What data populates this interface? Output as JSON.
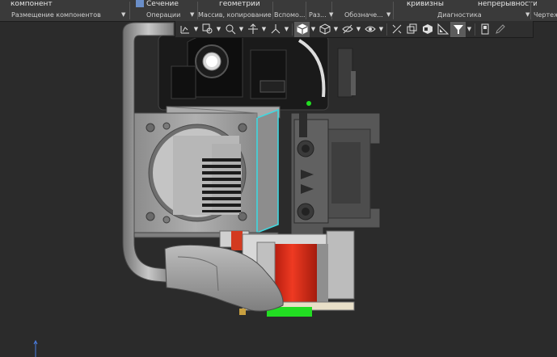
{
  "ribbon": {
    "cells": [
      {
        "id": "add-component",
        "label": "компонент"
      },
      {
        "id": "section",
        "label": "Сечение"
      },
      {
        "id": "geometry",
        "label": "геометрии"
      },
      {
        "id": "curvature",
        "label": "кривизны"
      },
      {
        "id": "continuity",
        "label": "непрерывности"
      }
    ],
    "groups": [
      {
        "id": "components",
        "label": "Размещение компонентов"
      },
      {
        "id": "operations",
        "label": "Операции"
      },
      {
        "id": "array",
        "label": "Массив, копирование"
      },
      {
        "id": "auxiliary",
        "label": "Вспомо..."
      },
      {
        "id": "dimensions",
        "label": "Раз..."
      },
      {
        "id": "designations",
        "label": "Обозначе..."
      },
      {
        "id": "diagnostics",
        "label": "Диагностика"
      },
      {
        "id": "drawing",
        "label": "Чертеж"
      }
    ]
  },
  "toolbar": {
    "buttons": [
      {
        "name": "orientation-icon",
        "caret": true
      },
      {
        "name": "zoom-window-icon",
        "caret": true
      },
      {
        "name": "pan-icon",
        "caret": true
      },
      {
        "name": "rotate-icon",
        "caret": true
      },
      {
        "name": "shaded-display-icon",
        "caret": true,
        "active": true
      },
      {
        "name": "perspective-icon",
        "caret": true
      },
      {
        "name": "hide-show-icon",
        "caret": true
      },
      {
        "name": "view-filter-icon",
        "caret": true
      },
      {
        "name": "constraints-icon",
        "caret": false
      },
      {
        "name": "layers-icon",
        "caret": false
      },
      {
        "name": "components-display-icon",
        "caret": false
      },
      {
        "name": "section-plane-icon",
        "caret": false
      },
      {
        "name": "selection-filter-icon",
        "caret": true,
        "active": true
      },
      {
        "name": "zone-icon",
        "caret": false
      },
      {
        "name": "pencil-icon",
        "caret": false
      }
    ]
  },
  "colors": {
    "background": "#2b2b2b",
    "highlight_edge": "#40d8e0",
    "accent_red": "#e8301c",
    "accent_green": "#22dd22"
  }
}
